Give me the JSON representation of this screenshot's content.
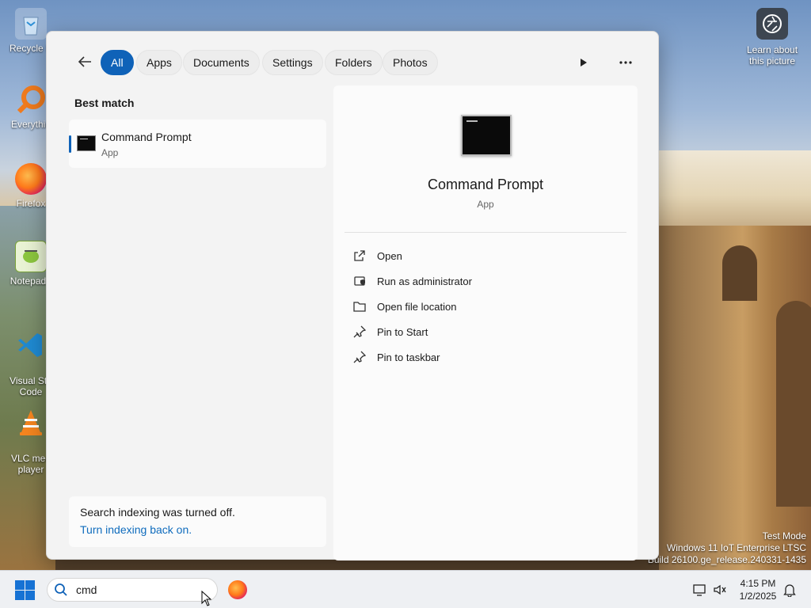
{
  "desktop": {
    "icons": [
      {
        "label": "Recycle B",
        "glyph": "recycle-bin-icon"
      },
      {
        "label": "Everythin",
        "glyph": "everything-search-icon"
      },
      {
        "label": "Firefox",
        "glyph": "firefox-icon"
      },
      {
        "label": "Notepad+",
        "glyph": "notepad-plus-plus-icon"
      },
      {
        "label": "Visual Stu\nCode",
        "glyph": "vscode-icon"
      },
      {
        "label": "VLC med\nplayer",
        "glyph": "vlc-icon"
      }
    ],
    "learn": {
      "line1": "Learn about",
      "line2": "this picture"
    },
    "watermark": {
      "line1": "Test Mode",
      "line2": "Windows 11 IoT Enterprise LTSC",
      "line3": "Build 26100.ge_release.240331-1435"
    }
  },
  "search_flyout": {
    "filters": [
      "All",
      "Apps",
      "Documents",
      "Settings",
      "Folders",
      "Photos"
    ],
    "active_filter": "All",
    "best_match_title": "Best match",
    "result": {
      "name": "Command Prompt",
      "kind": "App"
    },
    "notice": {
      "message": "Search indexing was turned off.",
      "link": "Turn indexing back on."
    },
    "detail": {
      "name": "Command Prompt",
      "kind": "App",
      "actions": [
        "Open",
        "Run as administrator",
        "Open file location",
        "Pin to Start",
        "Pin to taskbar"
      ]
    }
  },
  "taskbar": {
    "search_query": "cmd",
    "time": "4:15 PM",
    "date": "1/2/2025"
  },
  "colors": {
    "accent": "#0f62b8",
    "link": "#0f6cbd",
    "flyout_bg": "#f3f3f3"
  }
}
